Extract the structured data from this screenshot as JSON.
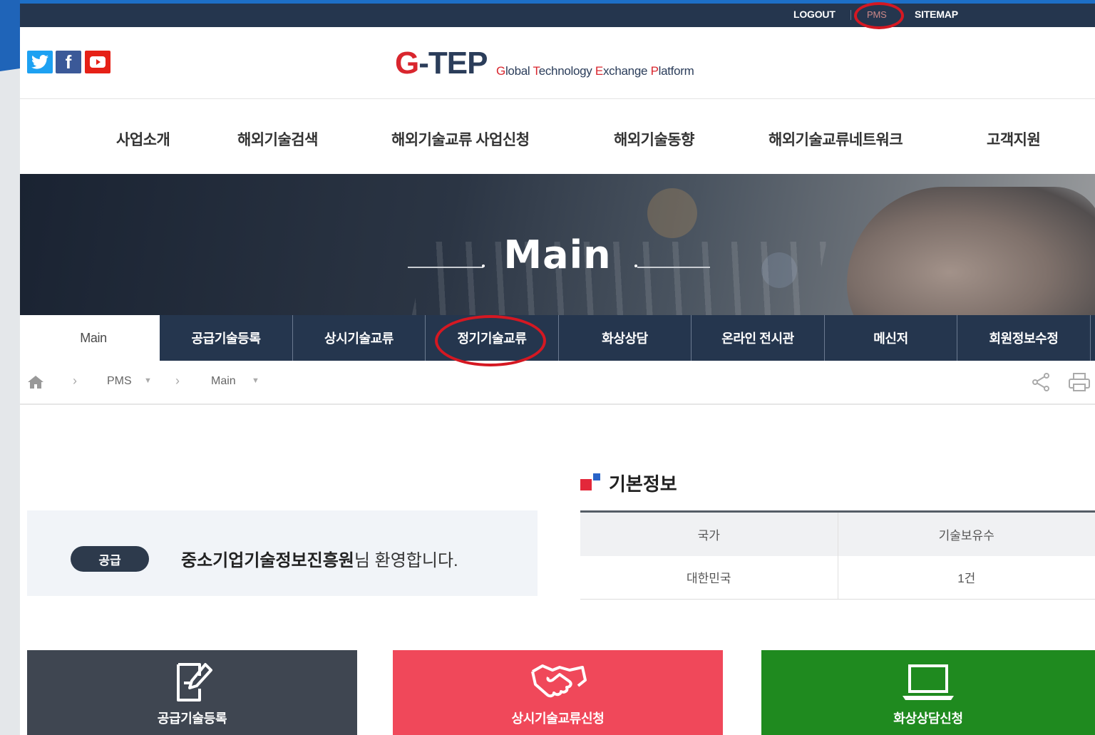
{
  "util": {
    "logout": "LOGOUT",
    "pms": "PMS",
    "sitemap": "SITEMAP"
  },
  "social": [
    {
      "icon": "twitter-icon",
      "glyph": "t",
      "color": "#1da1f2"
    },
    {
      "icon": "facebook-icon",
      "glyph": "f",
      "color": "#3b5998"
    },
    {
      "icon": "youtube-icon",
      "glyph": "▶",
      "color": "#e62117"
    }
  ],
  "logo": {
    "g": "G",
    "rest": "-TEP",
    "subtitle_g": "G",
    "subtitle_1": "lobal ",
    "subtitle_t": "T",
    "subtitle_2": "echnology ",
    "subtitle_e": "E",
    "subtitle_3": "xchange ",
    "subtitle_p": "P",
    "subtitle_4": "latform"
  },
  "nav": [
    "사업소개",
    "해외기술검색",
    "해외기술교류 사업신청",
    "해외기술동향",
    "해외기술교류네트워크",
    "고객지원"
  ],
  "banner": {
    "title": "Main"
  },
  "tabs": [
    "Main",
    "공급기술등록",
    "상시기술교류",
    "정기기술교류",
    "화상상담",
    "온라인 전시관",
    "메신저",
    "회원정보수정"
  ],
  "breadcrumb": {
    "level1": "PMS",
    "level2": "Main"
  },
  "welcome": {
    "badge": "공급",
    "org": "중소기업기술정보진흥원",
    "suffix": "님 환영합니다."
  },
  "basic_info": {
    "title": "기본정보",
    "headers": [
      "국가",
      "기술보유수"
    ],
    "row": [
      "대한민국",
      "1건"
    ]
  },
  "cards": [
    {
      "label": "공급기술등록",
      "icon": "edit-document-icon",
      "color": "#3f4651"
    },
    {
      "label": "상시기술교류신청",
      "icon": "handshake-icon",
      "color": "#f0485a"
    },
    {
      "label": "화상상담신청",
      "icon": "laptop-icon",
      "color": "#1f8a1f"
    }
  ]
}
